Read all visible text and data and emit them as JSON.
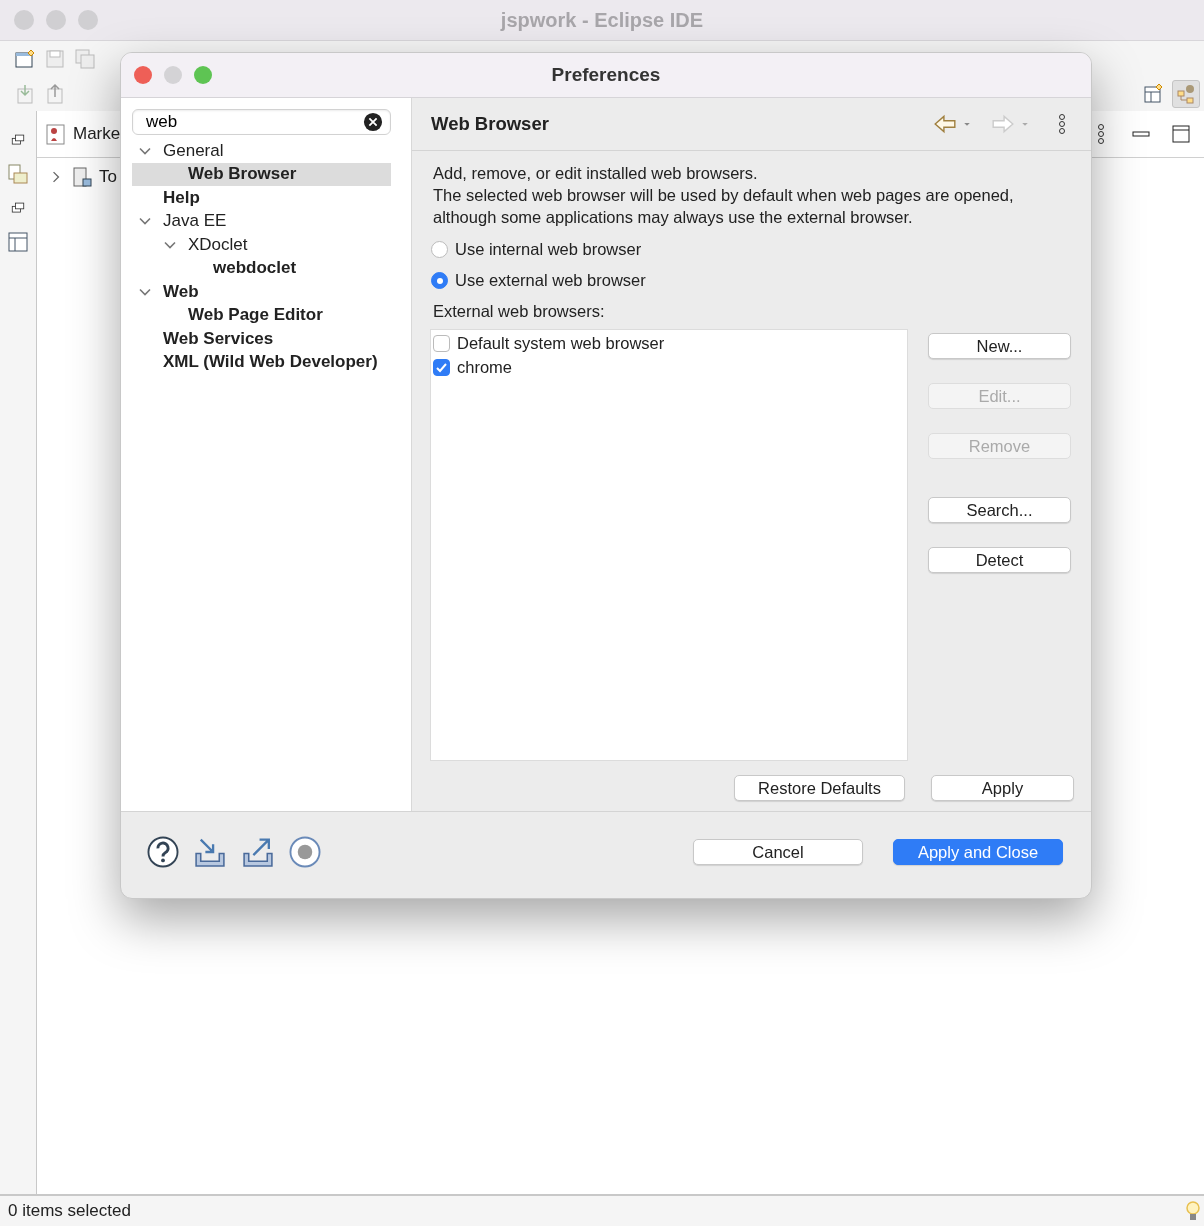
{
  "ide": {
    "title": "jspwork - Eclipse IDE",
    "view_tab": "Marke",
    "tree_item": "To",
    "status": "0 items selected"
  },
  "dialog": {
    "title": "Preferences",
    "filter": {
      "value": "web"
    },
    "tree": [
      {
        "label": "General",
        "match": false,
        "selected": false,
        "expanded": true,
        "children": [
          {
            "label": "Web Browser",
            "match": true,
            "selected": true
          }
        ]
      },
      {
        "label": "Help",
        "match": true,
        "selected": false
      },
      {
        "label": "Java EE",
        "match": false,
        "selected": false,
        "expanded": true,
        "children": [
          {
            "label": "XDoclet",
            "match": false,
            "selected": false,
            "expanded": true,
            "children": [
              {
                "label": "webdoclet",
                "match": true,
                "selected": false
              }
            ]
          }
        ]
      },
      {
        "label": "Web",
        "match": true,
        "selected": false,
        "expanded": true,
        "children": [
          {
            "label": "Web Page Editor",
            "match": true,
            "selected": false
          }
        ]
      },
      {
        "label": "Web Services",
        "match": true,
        "selected": false
      },
      {
        "label": "XML (Wild Web Developer)",
        "match": true,
        "selected": false
      }
    ],
    "page": {
      "title": "Web Browser",
      "description": "Add, remove, or edit installed web browsers.\nThe selected web browser will be used by default when web pages are opened, although some applications may always use the external browser.",
      "radios": [
        {
          "label": "Use internal web browser",
          "selected": false
        },
        {
          "label": "Use external web browser",
          "selected": true
        }
      ],
      "list_label": "External web browsers:",
      "browsers": [
        {
          "label": "Default system web browser",
          "checked": false
        },
        {
          "label": "chrome",
          "checked": true
        }
      ],
      "side_buttons": [
        {
          "label": "New...",
          "disabled": false
        },
        {
          "label": "Edit...",
          "disabled": true
        },
        {
          "label": "Remove",
          "disabled": true
        },
        {
          "label": "Search...",
          "disabled": false
        },
        {
          "label": "Detect",
          "disabled": false
        }
      ],
      "restore": "Restore Defaults",
      "apply": "Apply"
    },
    "footer": {
      "cancel": "Cancel",
      "ok": "Apply and Close"
    }
  }
}
